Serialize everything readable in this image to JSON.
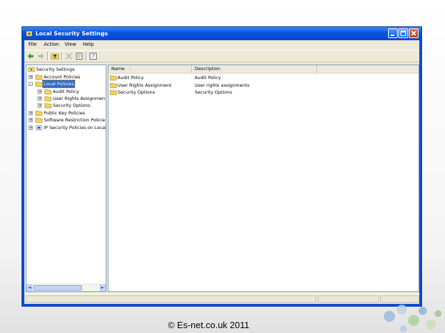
{
  "window": {
    "title": "Local Security Settings"
  },
  "menu": {
    "items": [
      "File",
      "Action",
      "View",
      "Help"
    ]
  },
  "tree": {
    "root": "Security Settings",
    "items": [
      {
        "label": "Account Policies",
        "expander": "+"
      },
      {
        "label": "Local Policies",
        "expander": "-",
        "selected": true
      },
      {
        "label": "Audit Policy",
        "expander": "+"
      },
      {
        "label": "User Rights Assignmen",
        "expander": "+"
      },
      {
        "label": "Security Options",
        "expander": "+"
      },
      {
        "label": "Public Key Policies",
        "expander": "+"
      },
      {
        "label": "Software Restriction Policie",
        "expander": "+"
      },
      {
        "label": "IP Security Policies on Local",
        "expander": "+"
      }
    ]
  },
  "list": {
    "columns": [
      "Name",
      "Description"
    ],
    "sort_indicator": "/",
    "rows": [
      {
        "name": "Audit Policy",
        "description": "Audit Policy"
      },
      {
        "name": "User Rights Assignment",
        "description": "User rights assignments"
      },
      {
        "name": "Security Options",
        "description": "Security Options"
      }
    ]
  },
  "footer": {
    "copyright": "© Es-net.co.uk 2011"
  },
  "colors": {
    "titlebar": "#0a55e0",
    "selection": "#316ac5",
    "folder": "#f2d45c"
  }
}
